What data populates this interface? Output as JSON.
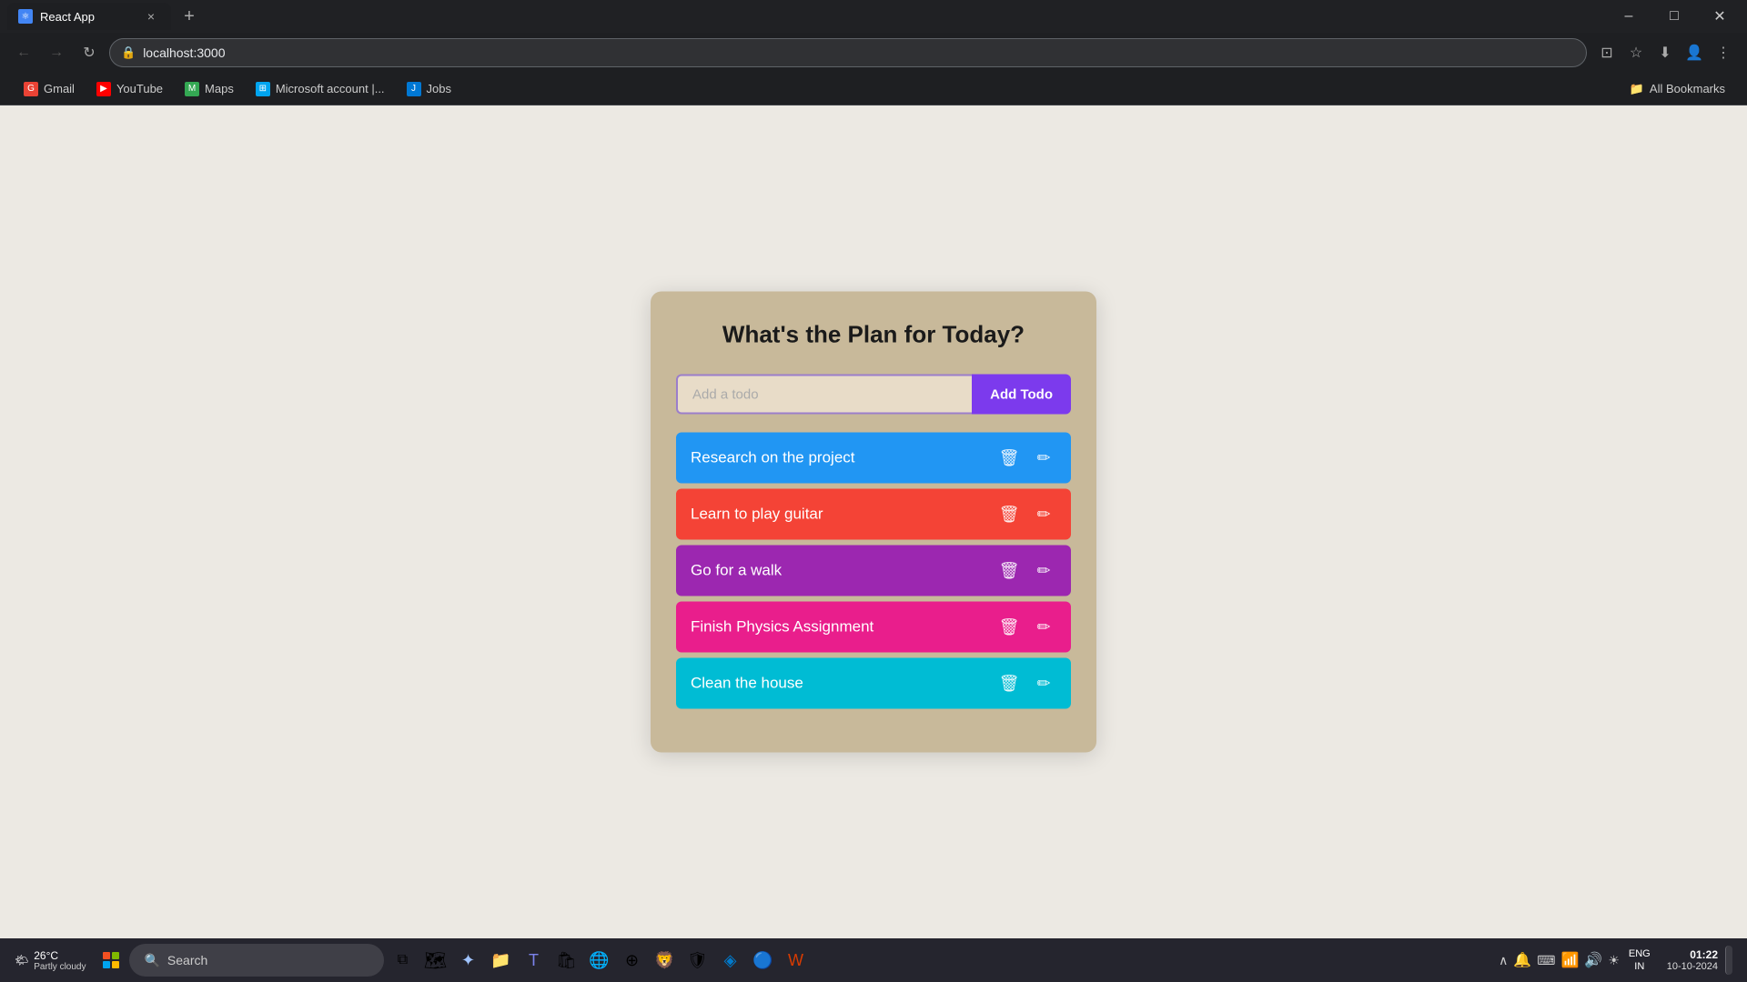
{
  "browser": {
    "tab": {
      "favicon": "⚛",
      "title": "React App",
      "close": "×"
    },
    "nav": {
      "back": "←",
      "forward": "→",
      "refresh": "↻",
      "url": "localhost:3000"
    },
    "bookmarks": [
      {
        "id": "gmail",
        "label": "Gmail",
        "color": "#ea4335"
      },
      {
        "id": "youtube",
        "label": "YouTube",
        "color": "#ff0000"
      },
      {
        "id": "maps",
        "label": "Maps",
        "color": "#34a853"
      },
      {
        "id": "microsoft",
        "label": "Microsoft account |...",
        "color": "#00a4ef"
      },
      {
        "id": "jobs",
        "label": "Jobs",
        "color": "#0078d4"
      }
    ],
    "all_bookmarks": "All Bookmarks"
  },
  "app": {
    "title": "What's the Plan for Today?",
    "input_placeholder": "Add a todo",
    "add_button": "Add Todo",
    "todos": [
      {
        "id": 1,
        "text": "Research on the project",
        "color": "blue"
      },
      {
        "id": 2,
        "text": "Learn to play guitar",
        "color": "orange"
      },
      {
        "id": 3,
        "text": "Go for a walk",
        "color": "purple"
      },
      {
        "id": 4,
        "text": "Finish Physics Assignment",
        "color": "pink"
      },
      {
        "id": 5,
        "text": "Clean the house",
        "color": "cyan"
      }
    ]
  },
  "taskbar": {
    "weather_temp": "26°C",
    "weather_desc": "Partly cloudy",
    "search_placeholder": "Search",
    "language": "ENG\nIN",
    "clock_time": "01:22",
    "clock_date": "10-10-2024"
  }
}
